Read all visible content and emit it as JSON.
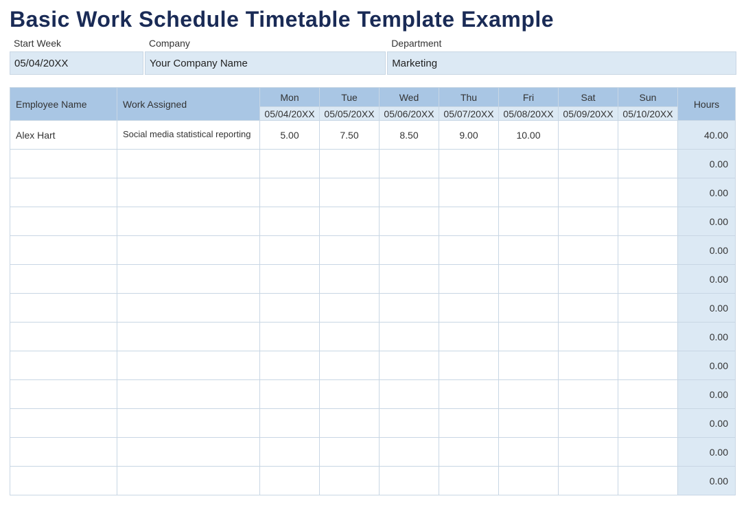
{
  "title": "Basic Work Schedule Timetable Template Example",
  "info": {
    "start_week_label": "Start Week",
    "start_week_value": "05/04/20XX",
    "company_label": "Company",
    "company_value": "Your Company Name",
    "department_label": "Department",
    "department_value": "Marketing"
  },
  "headers": {
    "employee": "Employee Name",
    "work": "Work Assigned",
    "hours": "Hours",
    "days": [
      {
        "name": "Mon",
        "date": "05/04/20XX"
      },
      {
        "name": "Tue",
        "date": "05/05/20XX"
      },
      {
        "name": "Wed",
        "date": "05/06/20XX"
      },
      {
        "name": "Thu",
        "date": "05/07/20XX"
      },
      {
        "name": "Fri",
        "date": "05/08/20XX"
      },
      {
        "name": "Sat",
        "date": "05/09/20XX"
      },
      {
        "name": "Sun",
        "date": "05/10/20XX"
      }
    ]
  },
  "rows": [
    {
      "employee": "Alex Hart",
      "work": "Social media statistical reporting",
      "days": [
        "5.00",
        "7.50",
        "8.50",
        "9.00",
        "10.00",
        "",
        ""
      ],
      "hours": "40.00"
    },
    {
      "employee": "",
      "work": "",
      "days": [
        "",
        "",
        "",
        "",
        "",
        "",
        ""
      ],
      "hours": "0.00"
    },
    {
      "employee": "",
      "work": "",
      "days": [
        "",
        "",
        "",
        "",
        "",
        "",
        ""
      ],
      "hours": "0.00"
    },
    {
      "employee": "",
      "work": "",
      "days": [
        "",
        "",
        "",
        "",
        "",
        "",
        ""
      ],
      "hours": "0.00"
    },
    {
      "employee": "",
      "work": "",
      "days": [
        "",
        "",
        "",
        "",
        "",
        "",
        ""
      ],
      "hours": "0.00"
    },
    {
      "employee": "",
      "work": "",
      "days": [
        "",
        "",
        "",
        "",
        "",
        "",
        ""
      ],
      "hours": "0.00"
    },
    {
      "employee": "",
      "work": "",
      "days": [
        "",
        "",
        "",
        "",
        "",
        "",
        ""
      ],
      "hours": "0.00"
    },
    {
      "employee": "",
      "work": "",
      "days": [
        "",
        "",
        "",
        "",
        "",
        "",
        ""
      ],
      "hours": "0.00"
    },
    {
      "employee": "",
      "work": "",
      "days": [
        "",
        "",
        "",
        "",
        "",
        "",
        ""
      ],
      "hours": "0.00"
    },
    {
      "employee": "",
      "work": "",
      "days": [
        "",
        "",
        "",
        "",
        "",
        "",
        ""
      ],
      "hours": "0.00"
    },
    {
      "employee": "",
      "work": "",
      "days": [
        "",
        "",
        "",
        "",
        "",
        "",
        ""
      ],
      "hours": "0.00"
    },
    {
      "employee": "",
      "work": "",
      "days": [
        "",
        "",
        "",
        "",
        "",
        "",
        ""
      ],
      "hours": "0.00"
    },
    {
      "employee": "",
      "work": "",
      "days": [
        "",
        "",
        "",
        "",
        "",
        "",
        ""
      ],
      "hours": "0.00"
    }
  ]
}
